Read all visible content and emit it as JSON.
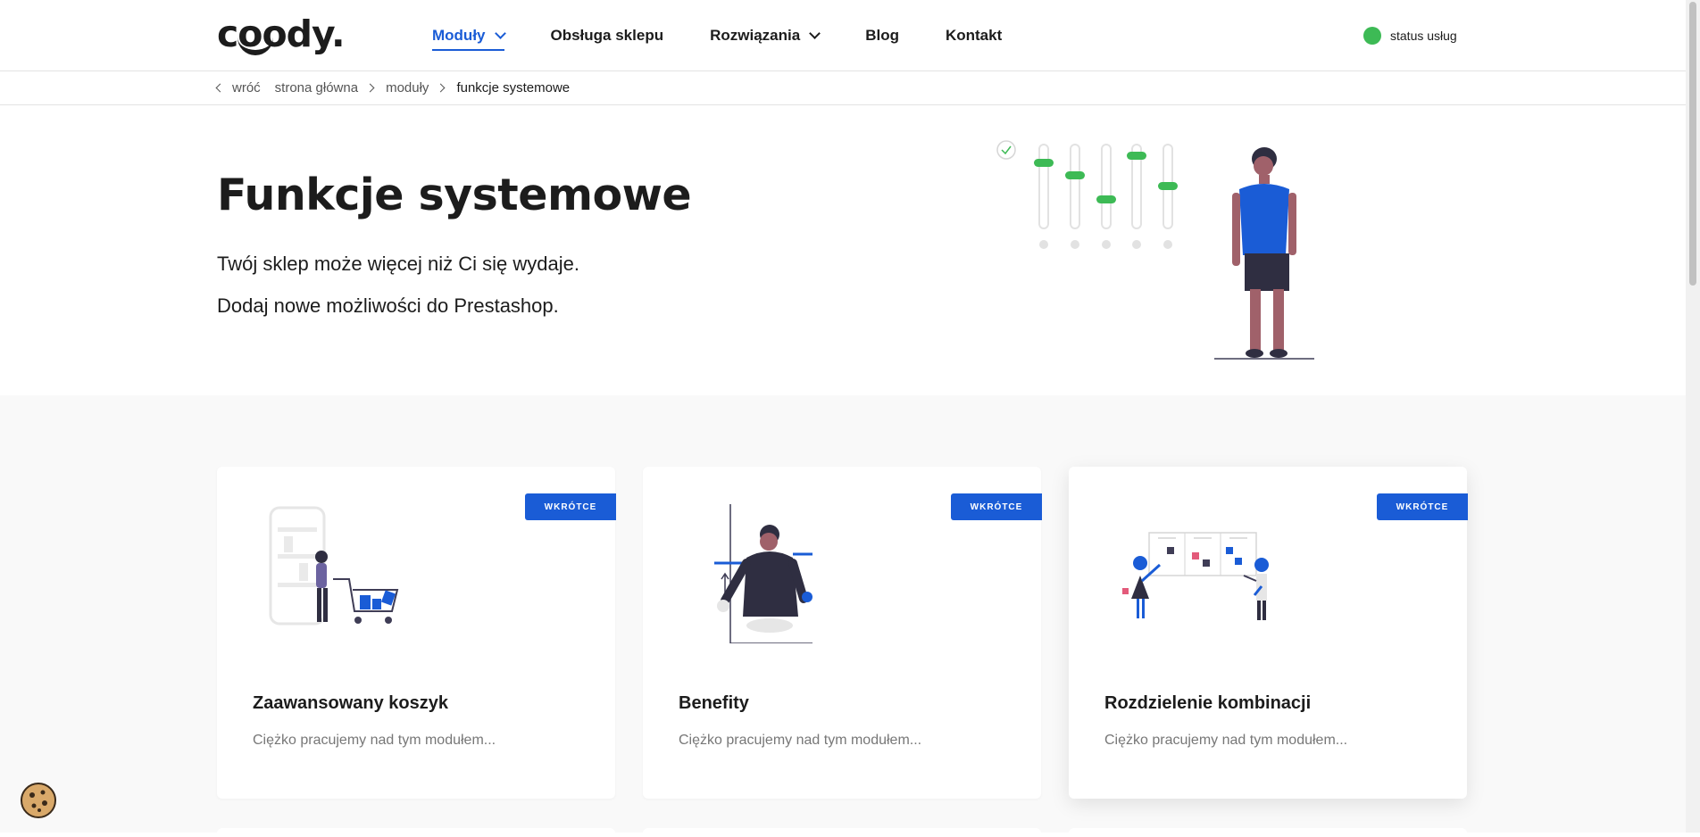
{
  "header": {
    "logo": "coody.",
    "nav": [
      {
        "label": "Moduły"
      },
      {
        "label": "Obsługa sklepu"
      },
      {
        "label": "Rozwiązania"
      },
      {
        "label": "Blog"
      },
      {
        "label": "Kontakt"
      }
    ],
    "status_label": "status usług",
    "status_color": "#3dba55"
  },
  "breadcrumb": {
    "back": "wróć",
    "items": [
      "strona główna",
      "moduły"
    ],
    "current": "funkcje systemowe"
  },
  "hero": {
    "title": "Funkcje systemowe",
    "line1": "Twój sklep może więcej niż Ci się wydaje.",
    "line2": "Dodaj nowe możliwości do Prestashop."
  },
  "cards": [
    {
      "badge": "WKRÓTCE",
      "title": "Zaawansowany koszyk",
      "desc": "Ciężko pracujemy nad tym modułem..."
    },
    {
      "badge": "WKRÓTCE",
      "title": "Benefity",
      "desc": "Ciężko pracujemy nad tym modułem..."
    },
    {
      "badge": "WKRÓTCE",
      "title": "Rozdzielenie kombinacji",
      "desc": "Ciężko pracujemy nad tym modułem..."
    }
  ],
  "colors": {
    "accent": "#1a5cd6",
    "green": "#3dba55",
    "text": "#1c1c1c"
  },
  "icons": [
    "chevron-down-icon",
    "chevron-left-icon",
    "chevron-right-icon",
    "cookie-icon"
  ]
}
